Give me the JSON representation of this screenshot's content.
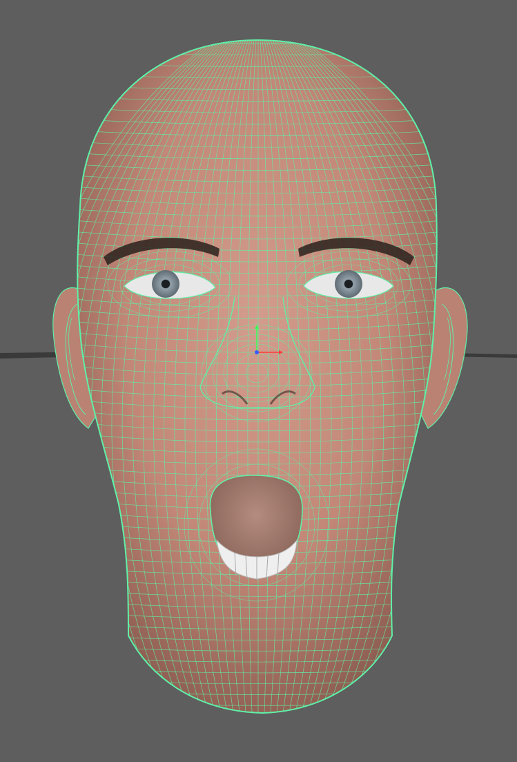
{
  "viewport": {
    "background_color": "#5e5e5e",
    "wireframe_color": "#5ff0a8",
    "skin_color": "#c98f80",
    "iris_color": "#8a98a3",
    "ground_grid_color": "#3a3a3a"
  },
  "head_model": {
    "display_mode": "wireframe-on-shaded",
    "expression": "mouth-open",
    "parts": [
      "cranium",
      "left-ear",
      "right-ear",
      "left-eye",
      "right-eye",
      "nose",
      "mouth",
      "teeth",
      "neck"
    ]
  },
  "manipulator": {
    "axes": [
      {
        "axis": "x",
        "color": "#ff3b3b"
      },
      {
        "axis": "y",
        "color": "#3bff5a"
      },
      {
        "axis": "z",
        "color": "#3b5bff"
      }
    ]
  },
  "icons": [
    "transform-manipulator-icon",
    "ground-grid-line"
  ]
}
